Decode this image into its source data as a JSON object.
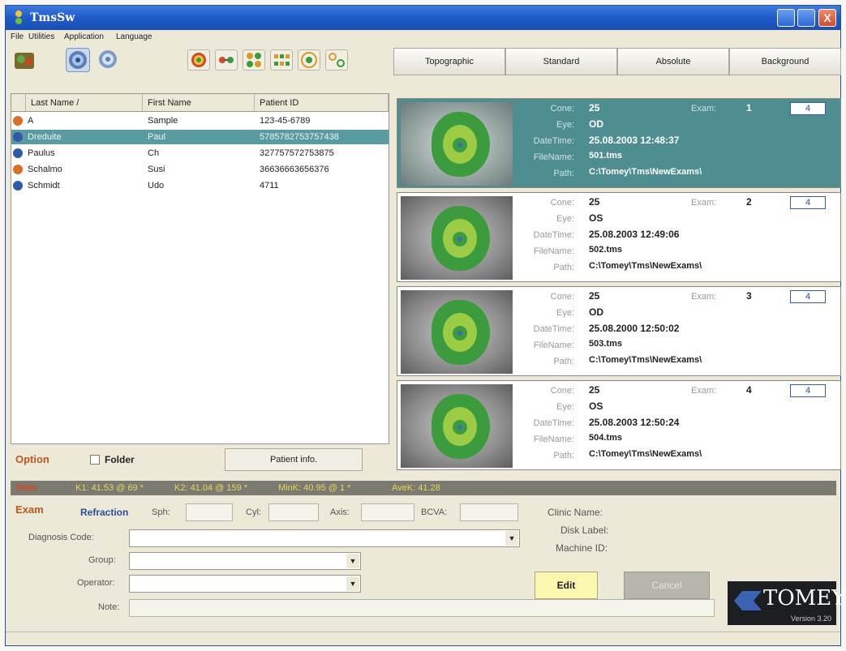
{
  "window": {
    "title": "TmsSw",
    "close_symbol": "X"
  },
  "menu": {
    "items": [
      {
        "label": "File"
      },
      {
        "label": "Utilities"
      },
      {
        "label": "Application"
      },
      {
        "label": "Language"
      }
    ]
  },
  "toolbar": {
    "icons": [
      "folder-people-icon",
      "eye-view-1-icon",
      "eye-view-2-icon",
      "color-map-icon",
      "compare-arrows-icon",
      "quad-view-icon",
      "grid-view-icon",
      "refraction-icon",
      "dual-eye-icon"
    ]
  },
  "view_tabs": [
    {
      "label": "Topographic"
    },
    {
      "label": "Standard"
    },
    {
      "label": "Absolute"
    },
    {
      "label": "Background"
    }
  ],
  "patient_list": {
    "columns": [
      "Last Name /",
      "First Name",
      "Patient ID"
    ],
    "rows": [
      {
        "last": "A",
        "first": "Sample",
        "id": "123-45-6789",
        "icon_color": "#d9702a",
        "selected": false
      },
      {
        "last": "Dreduite",
        "first": "Paul",
        "id": "5785782753757438",
        "icon_color": "#2f5aa8",
        "selected": true
      },
      {
        "last": "Paulus",
        "first": "Ch",
        "id": "327757572753875",
        "icon_color": "#2f5aa8",
        "selected": false
      },
      {
        "last": "Schalmo",
        "first": "Susi",
        "id": "36636663656376",
        "icon_color": "#d9702a",
        "selected": false
      },
      {
        "last": "Schmidt",
        "first": "Udo",
        "id": "4711",
        "icon_color": "#2f5aa8",
        "selected": false
      }
    ]
  },
  "options": {
    "label": "Option",
    "folder_label": "Folder",
    "patient_info_label": "Patient info."
  },
  "exam_labels": {
    "cone": "Cone:",
    "eye": "Eye:",
    "datetime": "DateTime:",
    "filename": "FileName:",
    "path": "Path:",
    "exam": "Exam:"
  },
  "exams": [
    {
      "cone": "25",
      "eye": "OD",
      "datetime": "25.08.2003 12:48:37",
      "filename": "501.tms",
      "path": "C:\\Tomey\\Tms\\NewExams\\",
      "exam_no": "1",
      "count": "4",
      "selected": true
    },
    {
      "cone": "25",
      "eye": "OS",
      "datetime": "25.08.2003 12:49:06",
      "filename": "502.tms",
      "path": "C:\\Tomey\\Tms\\NewExams\\",
      "exam_no": "2",
      "count": "4",
      "selected": false
    },
    {
      "cone": "25",
      "eye": "OD",
      "datetime": "25.08.2000 12:50:02",
      "filename": "503.tms",
      "path": "C:\\Tomey\\Tms\\NewExams\\",
      "exam_no": "3",
      "count": "4",
      "selected": false
    },
    {
      "cone": "25",
      "eye": "OS",
      "datetime": "25.08.2003 12:50:24",
      "filename": "504.tms",
      "path": "C:\\Tomey\\Tms\\NewExams\\",
      "exam_no": "4",
      "count": "4",
      "selected": false
    }
  ],
  "stats": {
    "label": "Stats",
    "k1": "K1: 41.53 @ 69 *",
    "k2": "K2: 41.04 @ 159 *",
    "mink": "MinK: 40.95 @ 1 *",
    "avek": "AveK: 41.28"
  },
  "exam_panel": {
    "title": "Exam",
    "refraction_label": "Refraction",
    "sph_label": "Sph:",
    "cyl_label": "Cyl:",
    "axis_label": "Axis:",
    "bcva_label": "BCVA:",
    "diagnosis_label": "Diagnosis Code:",
    "group_label": "Group:",
    "operator_label": "Operator:",
    "note_label": "Note:",
    "clinic_label": "Clinic Name:",
    "disk_label": "Disk Label:",
    "machine_label": "Machine ID:",
    "edit_label": "Edit",
    "cancel_label": "Cancel",
    "logo_text": "TOMEY",
    "version": "Version 3.20"
  },
  "colors": {
    "selection": "#5a9ba2",
    "accent_orange": "#c0571b",
    "title_blue": "#1f5bc8",
    "map_dark_green": "#3c9b3c",
    "map_light_green": "#9ccc46"
  }
}
